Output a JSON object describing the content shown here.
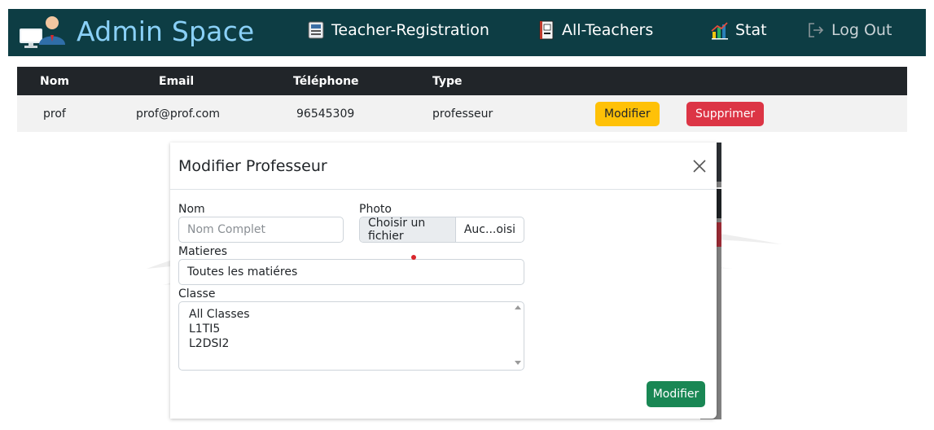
{
  "navbar": {
    "brand": "Admin Space",
    "links": [
      {
        "label": "Teacher-Registration",
        "icon": "registration-form-icon"
      },
      {
        "label": "All-Teachers",
        "icon": "contact-book-icon"
      },
      {
        "label": "Stat",
        "icon": "bar-chart-icon"
      },
      {
        "label": "Log Out",
        "icon": "logout-icon"
      }
    ]
  },
  "table": {
    "headers": [
      "Nom",
      "Email",
      "Téléphone",
      "Type"
    ],
    "rows": [
      {
        "nom": "prof",
        "email": "prof@prof.com",
        "telephone": "96545309",
        "type": "professeur",
        "edit_label": "Modifier",
        "delete_label": "Supprimer"
      }
    ]
  },
  "modal": {
    "title": "Modifier Professeur",
    "nom_label": "Nom",
    "nom_placeholder": "Nom Complet",
    "photo_label": "Photo",
    "file_button": "Choisir un fichier",
    "file_name": "Auc...oisi",
    "matieres_label": "Matieres",
    "matieres_value": "Toutes les matiéres",
    "classe_label": "Classe",
    "classe_options": [
      "All Classes",
      "L1TI5",
      "L2DSI2"
    ],
    "submit_label": "Modifier"
  },
  "colors": {
    "navbar_bg": "#0d3d44",
    "brand_text": "#8ad0f7",
    "warning": "#ffc107",
    "danger": "#dc3545",
    "success": "#198754"
  }
}
